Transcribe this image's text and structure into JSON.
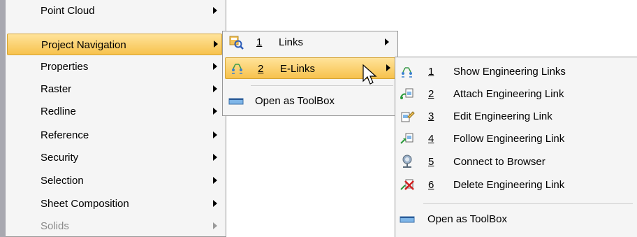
{
  "main_menu": {
    "items": [
      {
        "label": "Point Cloud"
      },
      {
        "label": "Project Navigation"
      },
      {
        "label": "Properties"
      },
      {
        "label": "Raster"
      },
      {
        "label": "Redline"
      },
      {
        "label": "Reference"
      },
      {
        "label": "Security"
      },
      {
        "label": "Selection"
      },
      {
        "label": "Sheet Composition"
      },
      {
        "label": "Solids"
      }
    ]
  },
  "project_navigation_menu": {
    "items": [
      {
        "number": "1",
        "label": "Links",
        "icon": "links-icon"
      },
      {
        "number": "2",
        "label": "E-Links",
        "icon": "elinks-icon"
      }
    ],
    "toolbox": {
      "label": "Open as ToolBox",
      "icon": "toolbox-icon"
    }
  },
  "elinks_menu": {
    "items": [
      {
        "number": "1",
        "label": "Show Engineering Links",
        "icon": "show-links-icon"
      },
      {
        "number": "2",
        "label": "Attach Engineering Link",
        "icon": "attach-link-icon"
      },
      {
        "number": "3",
        "label": "Edit Engineering Link",
        "icon": "edit-link-icon"
      },
      {
        "number": "4",
        "label": "Follow Engineering Link",
        "icon": "follow-link-icon"
      },
      {
        "number": "5",
        "label": "Connect to Browser",
        "icon": "browser-icon"
      },
      {
        "number": "6",
        "label": "Delete Engineering Link",
        "icon": "delete-link-icon"
      }
    ],
    "toolbox": {
      "label": "Open as ToolBox",
      "icon": "toolbox-icon"
    }
  },
  "colors": {
    "highlight": "#f7c24d",
    "menu_background": "#f5f5f5",
    "disabled_text": "#8a8a8a"
  }
}
